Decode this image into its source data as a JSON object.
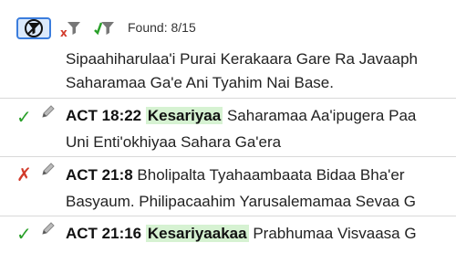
{
  "toolbar": {
    "found_text": "Found: 8/15",
    "buttons": [
      {
        "icon": "filter-off-icon",
        "active": true
      },
      {
        "icon": "filter-invalid-icon",
        "active": false
      },
      {
        "icon": "filter-valid-icon",
        "active": false
      }
    ]
  },
  "colors": {
    "accent": "#3b7ddd",
    "highlight": "#d6f2d2",
    "ok": "#2aa02a",
    "bad": "#d23b2b"
  },
  "entries": [
    {
      "status": "",
      "ref": "",
      "term": "",
      "line1_rest": "Sipaahiharulaa'i Purai Kerakaara Gare Ra Javaaph",
      "line2": "Saharamaa Ga'e Ani Tyahim Nai Base."
    },
    {
      "status": "valid",
      "status_glyph": "✓",
      "ref": "ACT 18:22",
      "term": "Kesariyaa",
      "line1_rest": "Saharamaa Aa'ipugera Paa",
      "line2": "Uni Enti'okhiyaa Sahara Ga'era"
    },
    {
      "status": "invalid",
      "status_glyph": "✗",
      "ref": "ACT 21:8",
      "term": "",
      "line1_rest": "Bholipalta Tyahaambaata Bidaa Bha'er",
      "line2": "Basyaum. Philipacaahim Yarusalemamaa Sevaa G"
    },
    {
      "status": "valid",
      "status_glyph": "✓",
      "ref": "ACT 21:16",
      "term": "Kesariyaakaa",
      "line1_rest": "Prabhumaa Visvaasa G",
      "line2": ""
    }
  ]
}
